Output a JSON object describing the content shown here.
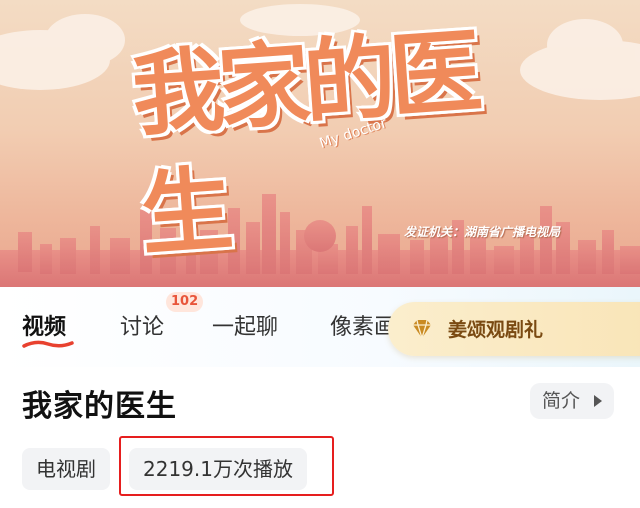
{
  "banner": {
    "poster_title": "我家的医生",
    "poster_subtitle": "My doctor",
    "license_text": "发证机关：湖南省广播电视局"
  },
  "tabs": [
    {
      "label": "视频",
      "active": true
    },
    {
      "label": "讨论",
      "badge": "102"
    },
    {
      "label": "一起聊"
    },
    {
      "label": "像素画"
    }
  ],
  "promo": {
    "label": "姜颂观剧礼",
    "icon": "gem-icon"
  },
  "show": {
    "title": "我家的医生",
    "intro_label": "简介",
    "tags": [
      "电视剧",
      "2219.1万次播放"
    ]
  },
  "colors": {
    "accent": "#e61e1e",
    "badge": "#e8553a",
    "promo_text": "#7a4a12"
  }
}
